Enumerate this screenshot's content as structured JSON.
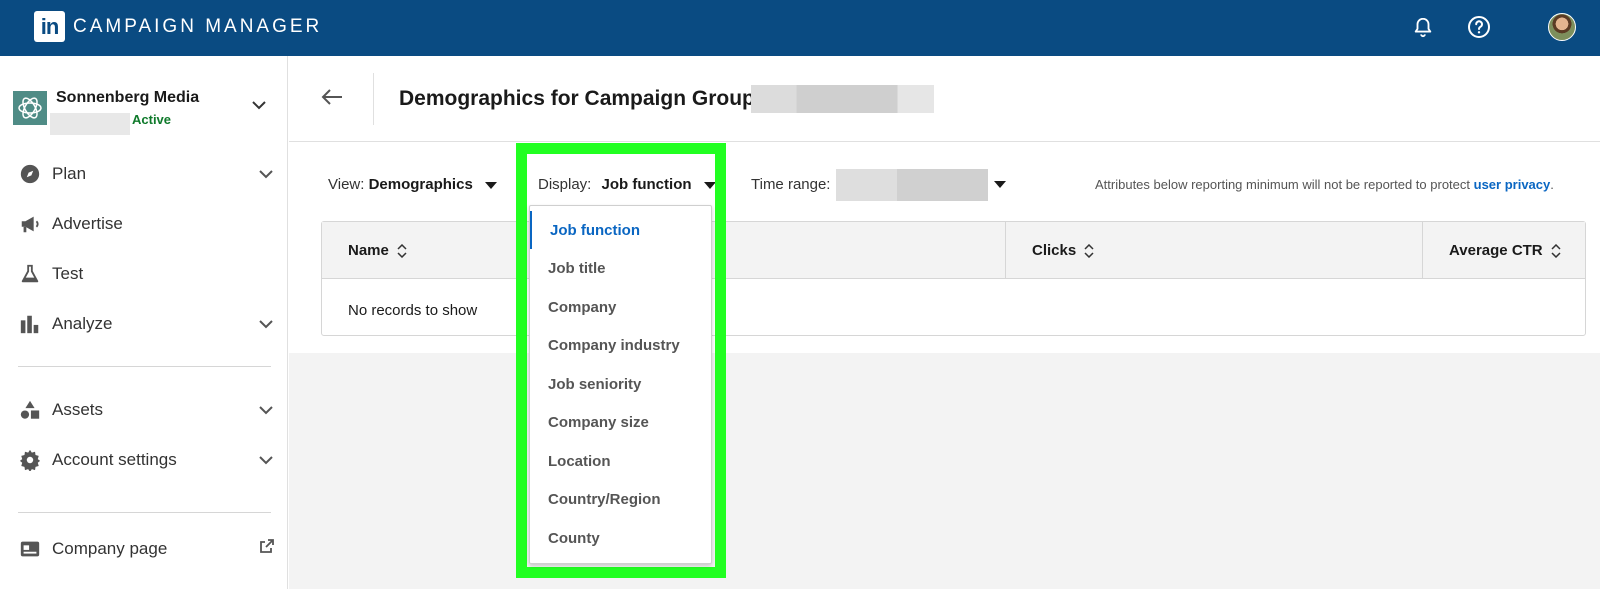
{
  "topbar": {
    "logo_text": "in",
    "brand": "CAMPAIGN MANAGER",
    "icons": [
      "bell-icon",
      "help-icon",
      "avatar"
    ],
    "bg_color": "#0a4b82"
  },
  "account": {
    "name": "Sonnenberg Media",
    "status": "Active"
  },
  "sidebar": {
    "items": [
      {
        "label": "Plan",
        "icon": "compass-icon",
        "expandable": true
      },
      {
        "label": "Advertise",
        "icon": "megaphone-icon",
        "expandable": false
      },
      {
        "label": "Test",
        "icon": "flask-icon",
        "expandable": false
      },
      {
        "label": "Analyze",
        "icon": "bar-chart-icon",
        "expandable": true
      },
      {
        "label": "Assets",
        "icon": "shapes-icon",
        "expandable": true
      },
      {
        "label": "Account settings",
        "icon": "gear-icon",
        "expandable": true
      },
      {
        "label": "Company page",
        "icon": "company-page-icon",
        "external": true
      }
    ]
  },
  "header": {
    "title": "Demographics for Campaign Group:"
  },
  "filters": {
    "view_label": "View:",
    "view_value": "Demographics",
    "display_label": "Display:",
    "display_value": "Job function",
    "time_label": "Time range:",
    "privacy_text": "Attributes below reporting minimum will not be reported to protect",
    "privacy_link": "user privacy"
  },
  "table": {
    "columns": [
      "Name",
      "Clicks",
      "Average CTR"
    ],
    "empty_text": "No records to show"
  },
  "dropdown": {
    "selected": "Job function",
    "options": [
      "Job function",
      "Job title",
      "Company",
      "Company industry",
      "Job seniority",
      "Company size",
      "Location",
      "Country/Region",
      "County"
    ]
  },
  "colors": {
    "accent": "#0a66c2",
    "highlight": "#21ff21",
    "active_status": "#0f7a2b"
  }
}
